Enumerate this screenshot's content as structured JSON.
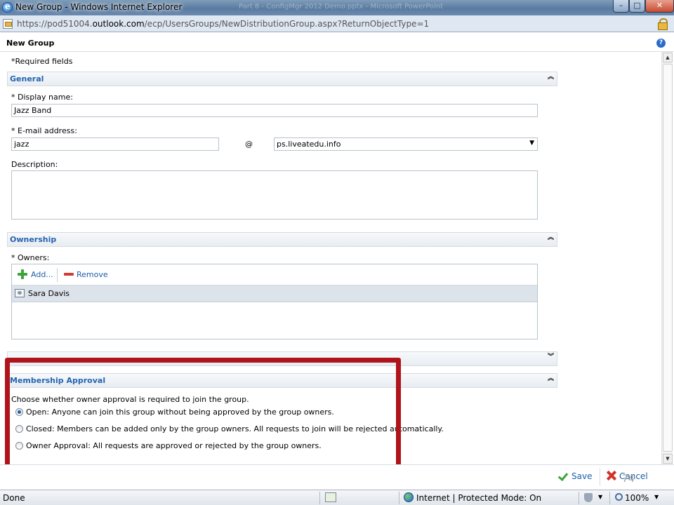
{
  "window": {
    "title": "New Group - Windows Internet Explorer",
    "background_title": "Part 8 - ConfigMgr 2012 Demo.pptx - Microsoft PowerPoint",
    "minimize": "–",
    "maximize": "□",
    "close": "✕"
  },
  "address": {
    "prefix": "https://pod51004.",
    "domain": "outlook.com",
    "path": "/ecp/UsersGroups/NewDistributionGroup.aspx?ReturnObjectType=1"
  },
  "page": {
    "title": "New Group",
    "required_note": "*Required fields"
  },
  "general": {
    "title": "General",
    "display_name_label": "* Display name:",
    "display_name_value": "Jazz Band",
    "email_label": "* E-mail address:",
    "email_value": "jazz",
    "at_sign": "@",
    "domain_value": "ps.liveatedu.info",
    "description_label": "Description:",
    "description_value": ""
  },
  "ownership": {
    "title": "Ownership",
    "owners_label": "* Owners:",
    "add_label": "Add...",
    "remove_label": "Remove",
    "owners": [
      "Sara Davis"
    ]
  },
  "membership_approval": {
    "title": "Membership Approval",
    "intro": "Choose whether owner approval is required to join the group.",
    "options": [
      {
        "label": "Open: Anyone can join this group without being approved by the group owners.",
        "selected": true
      },
      {
        "label": "Closed: Members can be added only by the group owners. All requests to join will be rejected automatically.",
        "selected": false
      },
      {
        "label": "Owner Approval: All requests are approved or rejected by the group owners.",
        "selected": false
      }
    ]
  },
  "actions": {
    "save_label": "Save",
    "cancel_label": "Cancel",
    "slide_number": "74"
  },
  "status": {
    "done": "Done",
    "zone": "Internet | Protected Mode: On",
    "zoom": "100%"
  },
  "colors": {
    "link": "#1d5ea8",
    "section_title": "#2464b0",
    "highlight_border": "#b01319"
  }
}
